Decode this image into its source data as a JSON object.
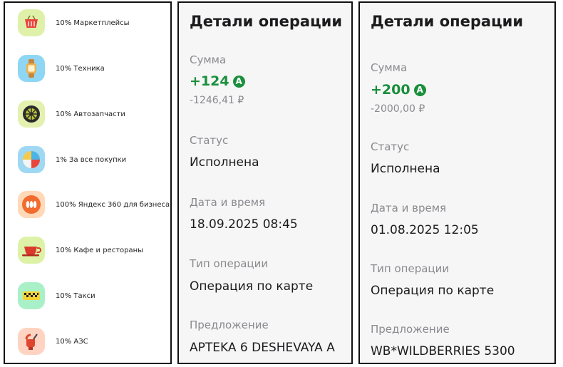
{
  "cashback_categories": [
    {
      "label": "10% Маркетплейсы",
      "icon": "basket-icon",
      "color": "#dff1a8"
    },
    {
      "label": "10% Техника",
      "icon": "smartwatch-icon",
      "color": "#8fd6f5"
    },
    {
      "label": "10% Автозапчасти",
      "icon": "wheel-icon",
      "color": "#e3f0b0"
    },
    {
      "label": "1% За все покупки",
      "icon": "pie-chart-icon",
      "color": "#9fd8f3"
    },
    {
      "label": "100% Яндекс 360 для бизнеса",
      "icon": "yandex360-icon",
      "color": "#ffd9b8"
    },
    {
      "label": "10% Кафе и рестораны",
      "icon": "cup-icon",
      "color": "#ddf2a6"
    },
    {
      "label": "10% Такси",
      "icon": "taxi-icon",
      "color": "#a9f0c8"
    },
    {
      "label": "10% АЗС",
      "icon": "fuel-nozzle-icon",
      "color": "#ffd3c2"
    }
  ],
  "operations": [
    {
      "title": "Детали операции",
      "amount_label": "Сумма",
      "bonus": "+124",
      "bonus_badge": "A",
      "amount": "-1246,41 ₽",
      "status_label": "Статус",
      "status": "Исполнена",
      "datetime_label": "Дата и время",
      "datetime": "18.09.2025 08:45",
      "type_label": "Тип операции",
      "type": "Операция по карте",
      "offer_label": "Предложение",
      "offer": "APTEKA 6 DESHEVAYA A"
    },
    {
      "title": "Детали операции",
      "amount_label": "Сумма",
      "bonus": "+200",
      "bonus_badge": "A",
      "amount": "-2000,00 ₽",
      "status_label": "Статус",
      "status": "Исполнена",
      "datetime_label": "Дата и время",
      "datetime": "01.08.2025 12:05",
      "type_label": "Тип операции",
      "type": "Операция по карте",
      "offer_label": "Предложение",
      "offer": "WB*WILDBERRIES 5300"
    }
  ],
  "colors": {
    "accent_green": "#1a8f3c",
    "secondary_text": "#8a8a8f"
  }
}
